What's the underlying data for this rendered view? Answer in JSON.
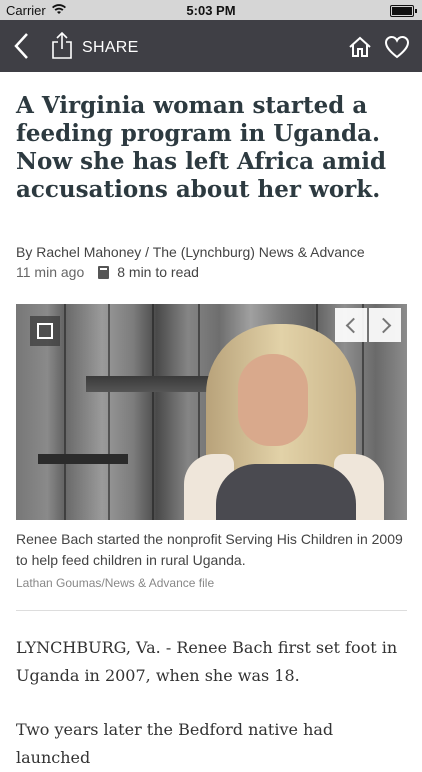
{
  "status_bar": {
    "carrier": "Carrier",
    "time": "5:03 PM",
    "battery_level": 1.0
  },
  "nav": {
    "share_label": "SHARE",
    "icons": [
      "back-icon",
      "share-icon",
      "home-icon",
      "heart-icon"
    ]
  },
  "article": {
    "headline": "A Virginia woman started a feeding program in Uganda. Now she has left Africa amid accusations about her work.",
    "byline": "By Rachel Mahoney / The (Lynchburg) News & Advance",
    "age": "11 min ago",
    "read_time": "8 min to read",
    "photo": {
      "caption": "Renee Bach started the nonprofit Serving His Children in 2009 to help feed children in rural Uganda.",
      "credit": "Lathan Goumas/News & Advance file"
    },
    "paragraphs": [
      "LYNCHBURG, Va. - Renee Bach first set foot in Uganda in 2007, when she was 18.",
      "Two years later the Bedford native had launched"
    ]
  },
  "colors": {
    "nav_bg": "#3f3f45",
    "headline": "#2d3a40",
    "status_bg": "#d6d6d6"
  }
}
